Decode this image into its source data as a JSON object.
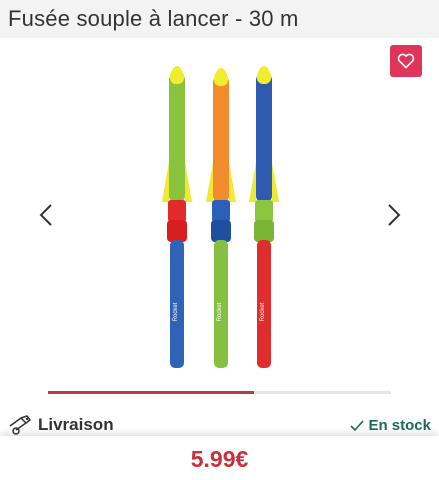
{
  "product": {
    "title": "Fusée souple à lancer - 30 m",
    "price": "5.99€"
  },
  "gallery": {
    "progress": 0.6,
    "icons": {
      "favorite": "heart-icon",
      "prev": "chevron-left-icon",
      "next": "chevron-right-icon"
    },
    "colors": {
      "favorite_bg": "#e0355a",
      "progress": "#b53d3d"
    }
  },
  "delivery": {
    "label": "Livraison",
    "icon": "delivery-icon",
    "stock_label": "En stock",
    "stock_icon": "check-icon",
    "stock_color": "#1d6b57"
  }
}
